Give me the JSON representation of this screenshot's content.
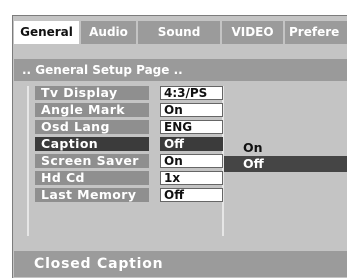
{
  "tabs": [
    {
      "label": "General",
      "active": true
    },
    {
      "label": "Audio",
      "active": false
    },
    {
      "label": "Sound",
      "active": false
    },
    {
      "label": "VIDEO",
      "active": false
    },
    {
      "label": "Prefere",
      "active": false
    }
  ],
  "page_title": ".. General Setup Page ..",
  "settings": [
    {
      "label": "Tv Display",
      "value": "4:3/PS"
    },
    {
      "label": "Angle Mark",
      "value": "On"
    },
    {
      "label": "Osd Lang",
      "value": "ENG"
    },
    {
      "label": "Caption",
      "value": "Off",
      "selected": true
    },
    {
      "label": "Screen Saver",
      "value": "On"
    },
    {
      "label": "Hd Cd",
      "value": "1x"
    },
    {
      "label": "Last Memory",
      "value": "Off"
    }
  ],
  "options": [
    {
      "label": "On",
      "selected": false
    },
    {
      "label": "Off",
      "selected": true
    }
  ],
  "help_text": "Closed Caption",
  "colors": {
    "panel": "#c4c4c4",
    "tab": "#9b9b9b",
    "label": "#8f8f8f",
    "highlight": "#3b3b3b"
  }
}
